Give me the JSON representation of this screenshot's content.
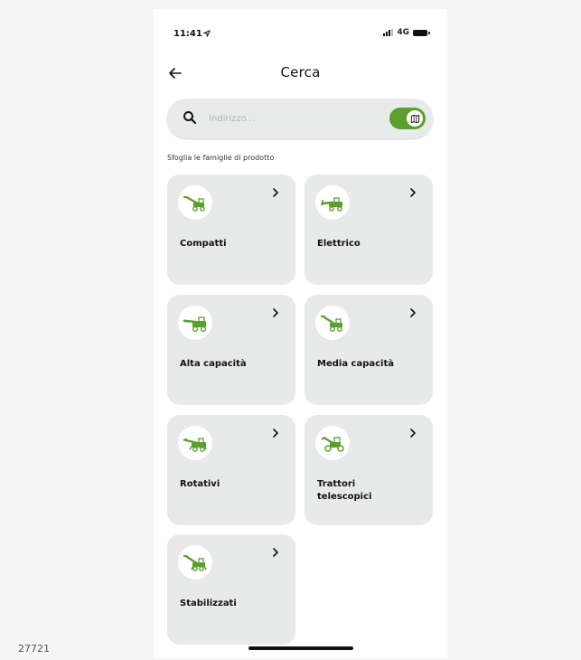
{
  "status_bar": {
    "time": "11:41",
    "network": "4G"
  },
  "header": {
    "title": "Cerca",
    "back_icon": "arrow-left-icon"
  },
  "search": {
    "placeholder": "Indirizzo...",
    "value": "",
    "toggle_state": "on",
    "toggle_icon": "map-icon"
  },
  "section_label": "Sfoglia le famiglie di prodotto",
  "categories": [
    {
      "label": "Compatti",
      "icon": "compact-telehandler-icon"
    },
    {
      "label": "Elettrico",
      "icon": "electric-telehandler-icon"
    },
    {
      "label": "Alta capacità",
      "icon": "high-capacity-telehandler-icon"
    },
    {
      "label": "Media capacità",
      "icon": "medium-capacity-telehandler-icon"
    },
    {
      "label": "Rotativi",
      "icon": "rotating-telehandler-icon"
    },
    {
      "label": "Trattori telescopici",
      "icon": "telescopic-tractor-icon"
    },
    {
      "label": "Stabilizzati",
      "icon": "stabilized-telehandler-icon"
    }
  ],
  "footer_code": "27721",
  "colors": {
    "accent": "#5aa02c",
    "card_bg": "#e8eae9",
    "search_bg": "#e9ebea"
  }
}
